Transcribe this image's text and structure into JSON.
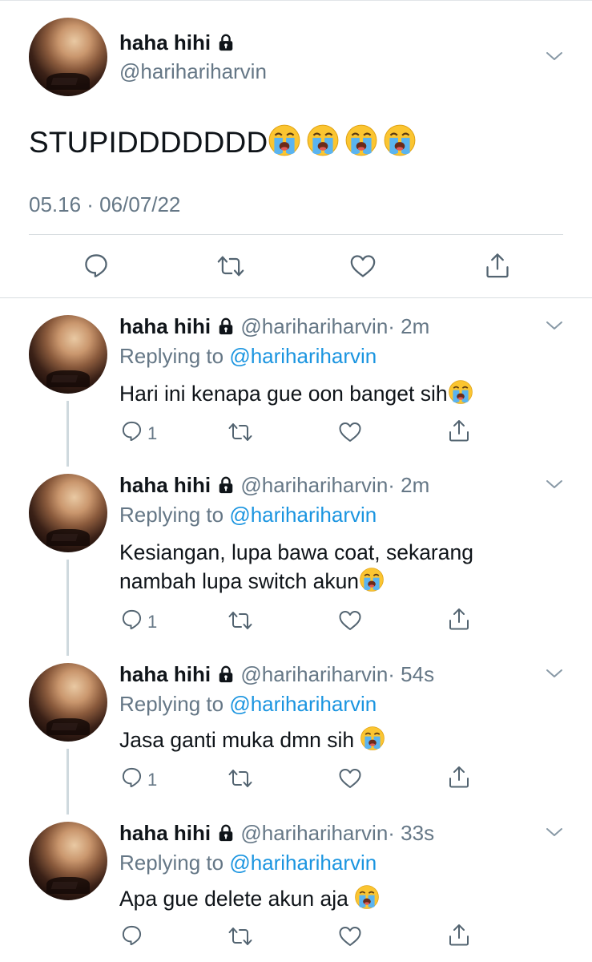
{
  "main_tweet": {
    "name": "haha hihi",
    "handle": "@harihariharvin",
    "text": "STUPIDDDDDDD",
    "emoji_count": 4,
    "timestamp": "05.16 · 06/07/22"
  },
  "replies": [
    {
      "name": "haha hihi",
      "handle": "@harihariharvin",
      "time": "· 2m",
      "replying_prefix": "Replying to",
      "replying_to": "@harihariharvin",
      "lines": [
        "Hari ini kenapa gue oon banget sih"
      ],
      "reply_count": "1"
    },
    {
      "name": "haha hihi",
      "handle": "@harihariharvin",
      "time": "· 2m",
      "replying_prefix": "Replying to",
      "replying_to": "@harihariharvin",
      "lines": [
        "Kesiangan, lupa bawa coat, sekarang",
        "nambah lupa switch akun"
      ],
      "reply_count": "1"
    },
    {
      "name": "haha hihi",
      "handle": "@harihariharvin",
      "time": "· 54s",
      "replying_prefix": "Replying to",
      "replying_to": "@harihariharvin",
      "lines": [
        "Jasa ganti muka dmn sih "
      ],
      "reply_count": "1"
    },
    {
      "name": "haha hihi",
      "handle": "@harihariharvin",
      "time": "· 33s",
      "replying_prefix": "Replying to",
      "replying_to": "@harihariharvin",
      "lines": [
        "Apa gue delete akun aja "
      ],
      "reply_count": ""
    }
  ],
  "icons": {
    "lock": "lock-icon",
    "chevron": "chevron-down-icon",
    "reply": "reply-icon",
    "retweet": "retweet-icon",
    "like": "like-icon",
    "share": "share-icon",
    "emoji": "loudly-crying-face-emoji"
  },
  "colors": {
    "text": "#0f1419",
    "secondary": "#657786",
    "link": "#1b95e0",
    "divider": "#d8dde1"
  }
}
